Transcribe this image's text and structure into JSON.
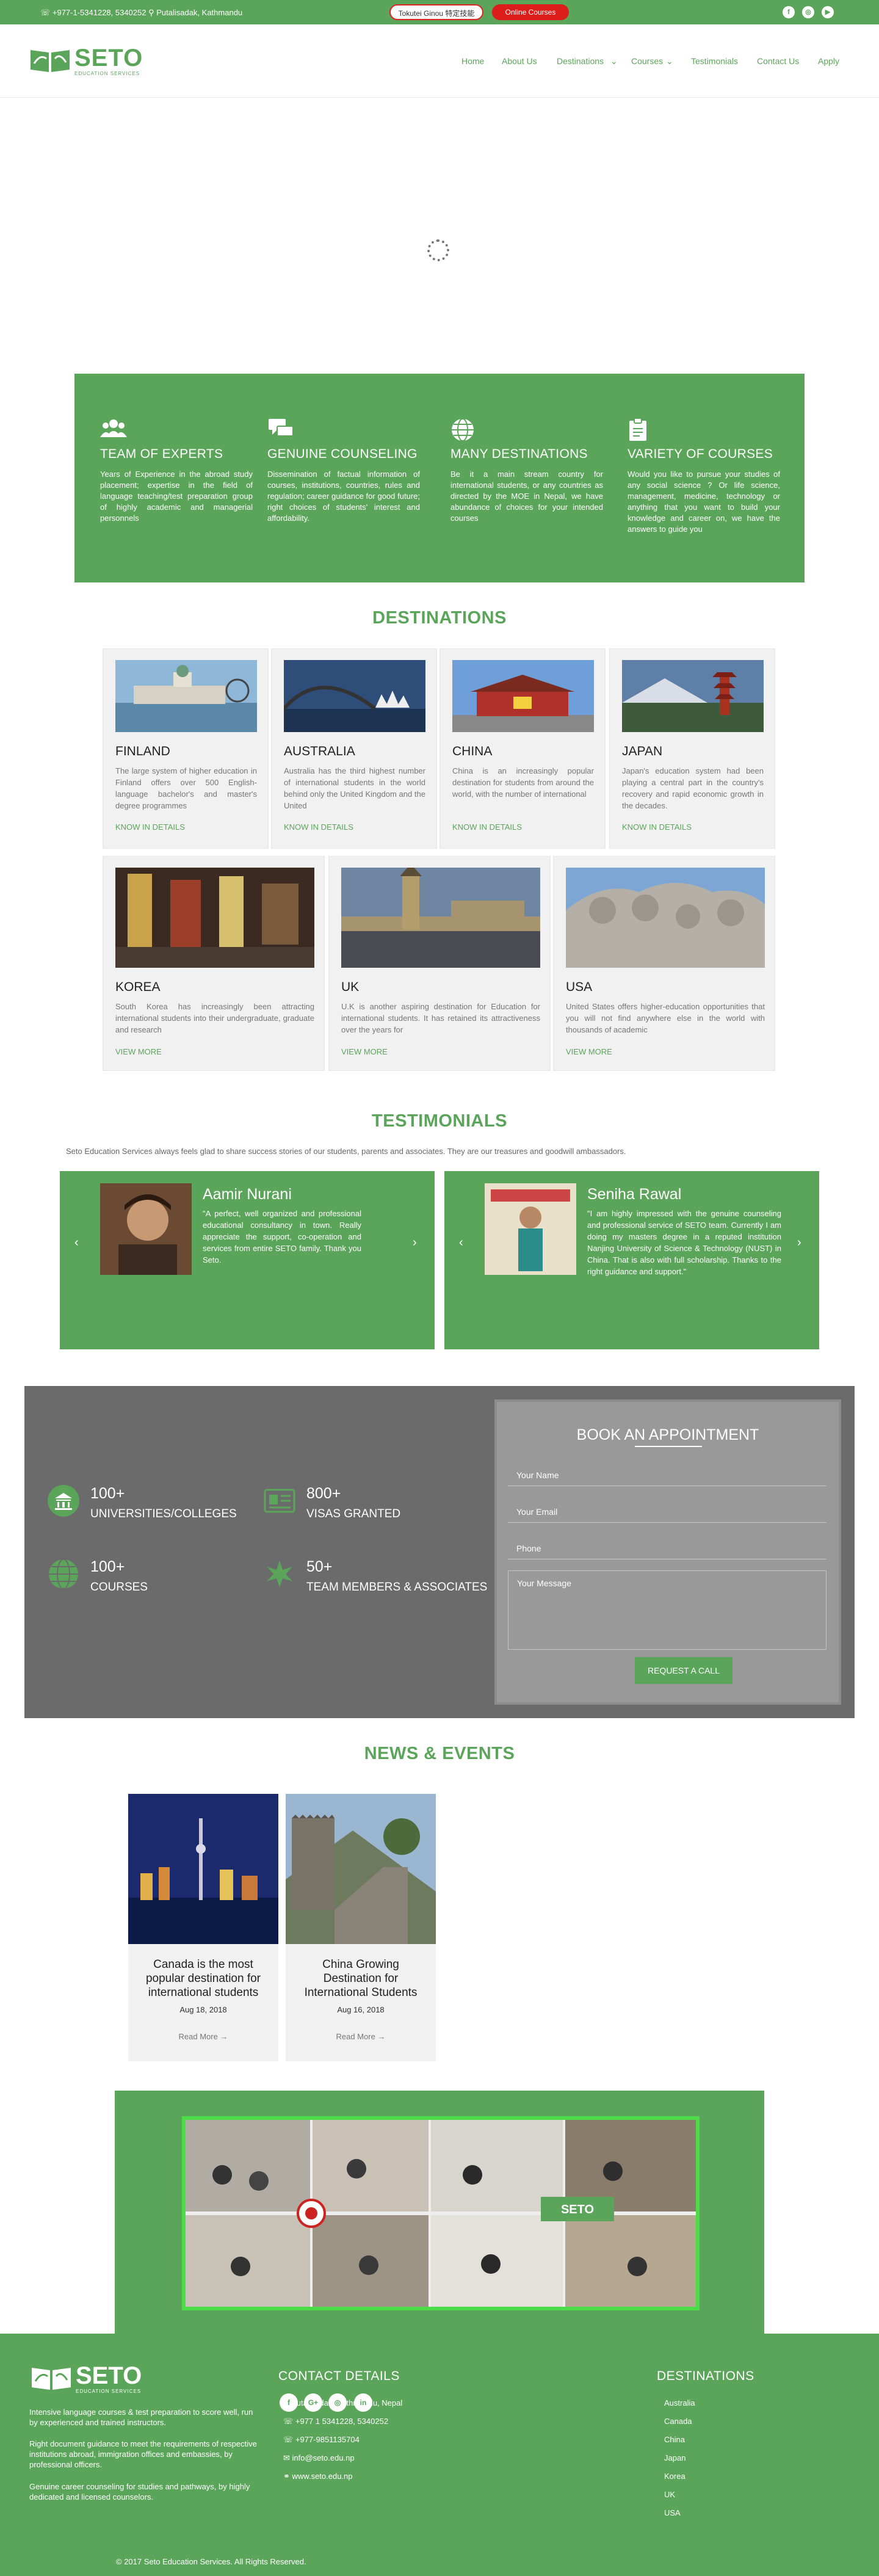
{
  "topbar": {
    "contact": "☏ +977-1-5341228, 5340252  ⚲ Putalisadak, Kathmandu",
    "btn1": "Tokutei Ginou 特定技能",
    "btn2": "Online Courses",
    "social": [
      "f",
      "◎",
      "▶"
    ]
  },
  "header": {
    "logo_title": "SETO",
    "logo_sub": "EDUCATION SERVICES",
    "nav": [
      "Home",
      "About Us",
      "Destinations",
      "Courses",
      "Testimonials",
      "Contact Us",
      "Apply"
    ]
  },
  "features": [
    {
      "title": "TEAM OF EXPERTS",
      "icon": "team-icon",
      "text": "Years of Experience in the abroad study placement; expertise in the field of language teaching/test preparation group of highly academic and managerial personnels"
    },
    {
      "title": "GENUINE COUNSELING",
      "icon": "chat-icon",
      "text": "Dissemination of factual information of courses, institutions, countries, rules and regulation; career guidance for good future; right choices of students' interest and affordability."
    },
    {
      "title": "MANY DESTINATIONS",
      "icon": "globe-icon",
      "text": "Be it a main stream country for international students, or any countries as directed by the MOE in Nepal, we have abundance of choices for your intended courses"
    },
    {
      "title": "VARIETY OF COURSES",
      "icon": "clipboard-icon",
      "text": "Would you like to pursue your studies of any social science ? Or life science, management, medicine, technology or anything that you want to build your knowledge and career on, we have the answers to guide you"
    }
  ],
  "destinations": {
    "title": "DESTINATIONS",
    "row1": [
      {
        "name": "FINLAND",
        "text": "The large system of higher education in Finland offers over 500 English-language bachelor's and master's degree programmes",
        "link": "KNOW IN DETAILS"
      },
      {
        "name": "AUSTRALIA",
        "text": "Australia has the third highest number of international students in the world behind only the United Kingdom and the United",
        "link": "KNOW IN DETAILS"
      },
      {
        "name": "CHINA",
        "text": "China is an increasingly popular destination for students from around the world, with the number of international",
        "link": "KNOW IN DETAILS"
      },
      {
        "name": "JAPAN",
        "text": "Japan's education system had been playing a central part in the country's recovery and rapid economic growth in the decades.",
        "link": "KNOW IN DETAILS"
      }
    ],
    "row2": [
      {
        "name": "KOREA",
        "text": "South Korea has increasingly been attracting international students into their undergraduate, graduate and research",
        "link": "VIEW MORE"
      },
      {
        "name": "UK",
        "text": "U.K is another aspiring destination for Education for international students. It has retained its attractiveness over the years for",
        "link": "VIEW MORE"
      },
      {
        "name": "USA",
        "text": "United States offers higher-education opportunities that you will not find anywhere else in the world with thousands of academic",
        "link": "VIEW MORE"
      }
    ]
  },
  "testimonials": {
    "title": "TESTIMONIALS",
    "intro": "Seto Education Services always feels glad to share success stories of our students, parents and associates. They are our treasures and goodwill ambassadors.",
    "items": [
      {
        "name": "Aamir Nurani",
        "quote": "\"A perfect, well organized and professional educational consultancy in town. Really appreciate the support, co-operation and services from entire SETO family. Thank you Seto."
      },
      {
        "name": "Seniha Rawal",
        "quote": "\"I am highly impressed with the genuine counseling and professional service of SETO team. Currently I am doing my masters degree in a reputed institution Nanjing University of Science & Technology (NUST) in China. That is also with full scholarship. Thanks to the right guidance and support.\""
      }
    ]
  },
  "stats": [
    {
      "num": "100+",
      "label": "UNIVERSITIES/COLLEGES",
      "icon": "university-icon"
    },
    {
      "num": "800+",
      "label": "VISAS GRANTED",
      "icon": "visa-icon"
    },
    {
      "num": "100+",
      "label": "COURSES",
      "icon": "globe-icon"
    },
    {
      "num": "50+",
      "label": "TEAM MEMBERS & ASSOCIATES",
      "icon": "star-icon"
    }
  ],
  "booking": {
    "title": "BOOK AN APPOINTMENT",
    "name_ph": "Your Name",
    "email_ph": "Your Email",
    "phone_ph": "Phone",
    "msg_ph": "Your Message",
    "button": "REQUEST A CALL"
  },
  "news": {
    "title": "NEWS & EVENTS",
    "items": [
      {
        "title": "Canada is the most popular destination for international students",
        "date": "Aug 18, 2018",
        "link": "Read More →"
      },
      {
        "title": "China Growing Destination for International Students",
        "date": "Aug 16, 2018",
        "link": "Read More →"
      }
    ]
  },
  "footer": {
    "logo_title": "SETO",
    "logo_sub": "EDUCATION SERVICES",
    "about": [
      "Intensive language courses & test preparation to score well, run by experienced and trained instructors.",
      "Right document guidance to meet the requirements of respective institutions abroad, immigration offices and embassies, by professional officers.",
      "Genuine career counseling for studies and pathways, by highly dedicated and licensed counselors."
    ],
    "contact_title": "CONTACT DETAILS",
    "contact": [
      "⚲ Putalisadak, Kathmandu, Nepal",
      "☏ +977 1 5341228, 5340252",
      "☏ +977-9851135704",
      "✉ info@seto.edu.np",
      "⚭ www.seto.edu.np"
    ],
    "social": [
      "f",
      "G+",
      "◎",
      "in"
    ],
    "dest_title": "DESTINATIONS",
    "destinations": [
      "Australia",
      "Canada",
      "China",
      "Japan",
      "Korea",
      "UK",
      "USA"
    ],
    "copyright": "© 2017 Seto Education Services. All Rights Reserved."
  },
  "colors": {
    "brand": "#5ba55a",
    "dark": "#6b6b6b",
    "red": "#dd1c1c"
  }
}
